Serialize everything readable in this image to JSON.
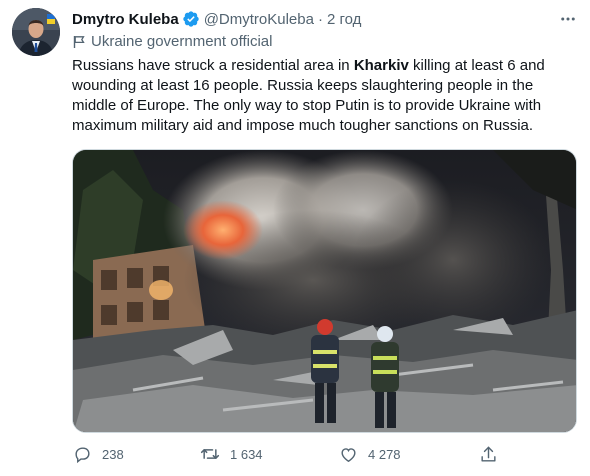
{
  "author": {
    "name": "Dmytro Kuleba",
    "handle": "@DmytroKuleba",
    "separator": "·",
    "time": "2 год",
    "label": "Ukraine government official"
  },
  "tweet": {
    "seg1": "Russians have struck a residential area in ",
    "seg_bold": "Kharkiv",
    "seg2": " killing at least 6 and wounding at least 16 people. Russia keeps slaughtering people in the middle of Europe. The only way to stop Putin is to provide Ukraine with maximum military aid and impose much tougher sanctions on Russia."
  },
  "actions": {
    "replies": "238",
    "retweets": "1 634",
    "likes": "4 278"
  },
  "colors": {
    "verified": "#1d9bf0",
    "secondary_text": "#536471",
    "primary_text": "#0f1419"
  },
  "icons": [
    "verified-badge-icon",
    "more-icon",
    "flag-icon",
    "reply-icon",
    "retweet-icon",
    "like-icon",
    "share-icon"
  ]
}
